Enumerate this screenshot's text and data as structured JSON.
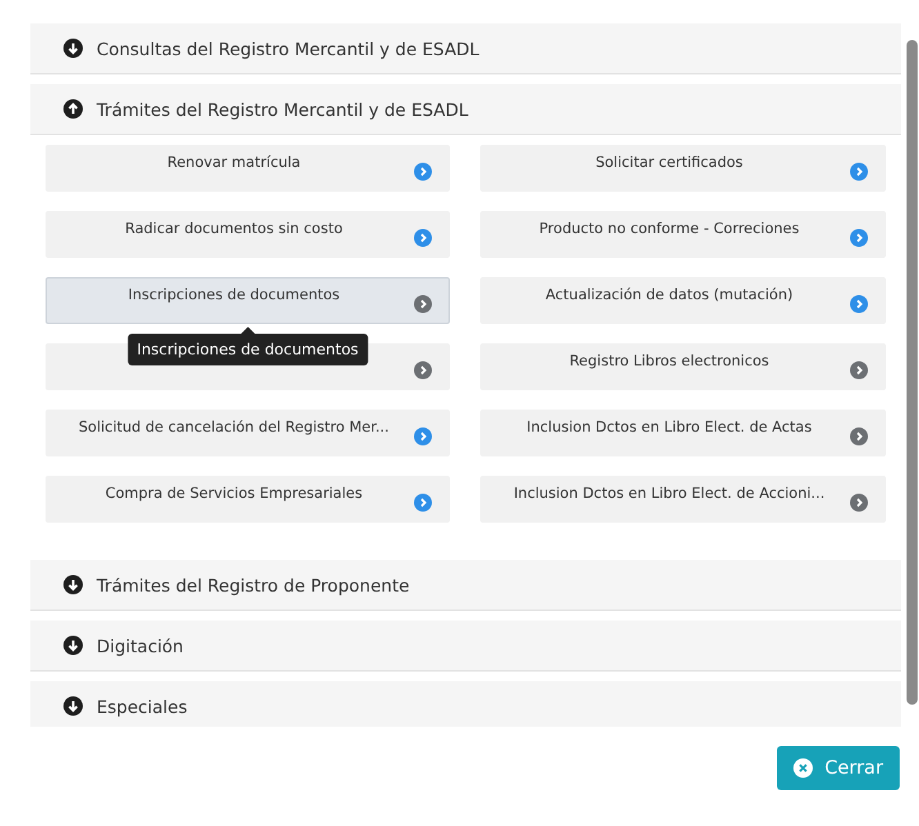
{
  "sections": [
    {
      "title": "Consultas del Registro Mercantil y de ESADL",
      "expanded": false
    },
    {
      "title": "Trámites del Registro Mercantil y de ESADL",
      "expanded": true,
      "items": [
        {
          "label": "Renovar matrícula",
          "enabled": true,
          "hovered": false
        },
        {
          "label": "Solicitar certificados",
          "enabled": true,
          "hovered": false
        },
        {
          "label": "Radicar documentos sin costo",
          "enabled": true,
          "hovered": false
        },
        {
          "label": "Producto no conforme - Correciones",
          "enabled": true,
          "hovered": false
        },
        {
          "label": "Inscripciones de documentos",
          "enabled": false,
          "hovered": true,
          "tooltip": "Inscripciones de documentos"
        },
        {
          "label": "Actualización de datos (mutación)",
          "enabled": true,
          "hovered": false
        },
        {
          "enabled": false,
          "hovered": false
        },
        {
          "label": "Registro Libros electronicos",
          "enabled": false,
          "hovered": false
        },
        {
          "label": "Solicitud de cancelación del Registro Mer...",
          "enabled": true,
          "hovered": false
        },
        {
          "label": "Inclusion Dctos en Libro Elect. de Actas",
          "enabled": false,
          "hovered": false
        },
        {
          "label": "Compra de Servicios Empresariales",
          "enabled": true,
          "hovered": false
        },
        {
          "label": "Inclusion Dctos en Libro Elect. de Accioni...",
          "enabled": false,
          "hovered": false
        }
      ]
    },
    {
      "title": "Trámites del Registro de Proponente",
      "expanded": false
    },
    {
      "title": "Digitación",
      "expanded": false
    },
    {
      "title": "Especiales",
      "expanded": false
    }
  ],
  "close_button": "Cerrar"
}
